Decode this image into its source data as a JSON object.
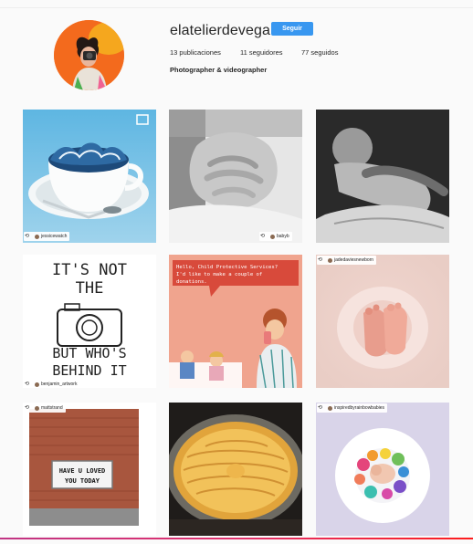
{
  "profile": {
    "username": "elatelierdevega",
    "follow_label": "Seguir",
    "posts_count": "13 publicaciones",
    "followers_count": "11 seguidores",
    "following_count": "77 seguidos",
    "bio": "Photographer & videographer"
  },
  "posts": [
    {
      "name": "post-tea-cup-storm",
      "tag": "jessicewatch"
    },
    {
      "name": "post-baby-hand",
      "tag": "babyb"
    },
    {
      "name": "post-sleeping-baby",
      "tag": ""
    },
    {
      "name": "post-camera-quote",
      "tag": "benjamin_artwork",
      "text_lines": [
        "IT'S NOT",
        "THE",
        "BUT WHO'S",
        "BEHIND IT"
      ]
    },
    {
      "name": "post-vintage-ad",
      "tag": "",
      "bubble_lines": [
        "Hello, Child Protective Services?",
        "I'd like to make a couple of",
        "donations."
      ]
    },
    {
      "name": "post-baby-feet",
      "tag": "jadedaviesnewborn"
    },
    {
      "name": "post-brick-sign",
      "tag": "mattstrand",
      "sign_lines": [
        "HAVE U LOVED",
        "YOU TODAY"
      ]
    },
    {
      "name": "post-apple-tart",
      "tag": ""
    },
    {
      "name": "post-flower-baby",
      "tag": "inspiredbyrainbowbabies"
    }
  ],
  "colors": {
    "accent": "#3897f0",
    "avatar_bg": "#f36a1d",
    "bottom_bar": "#e1306c"
  },
  "icons": {
    "repost": "repost-icon",
    "multi": "multiple-photos-icon"
  }
}
